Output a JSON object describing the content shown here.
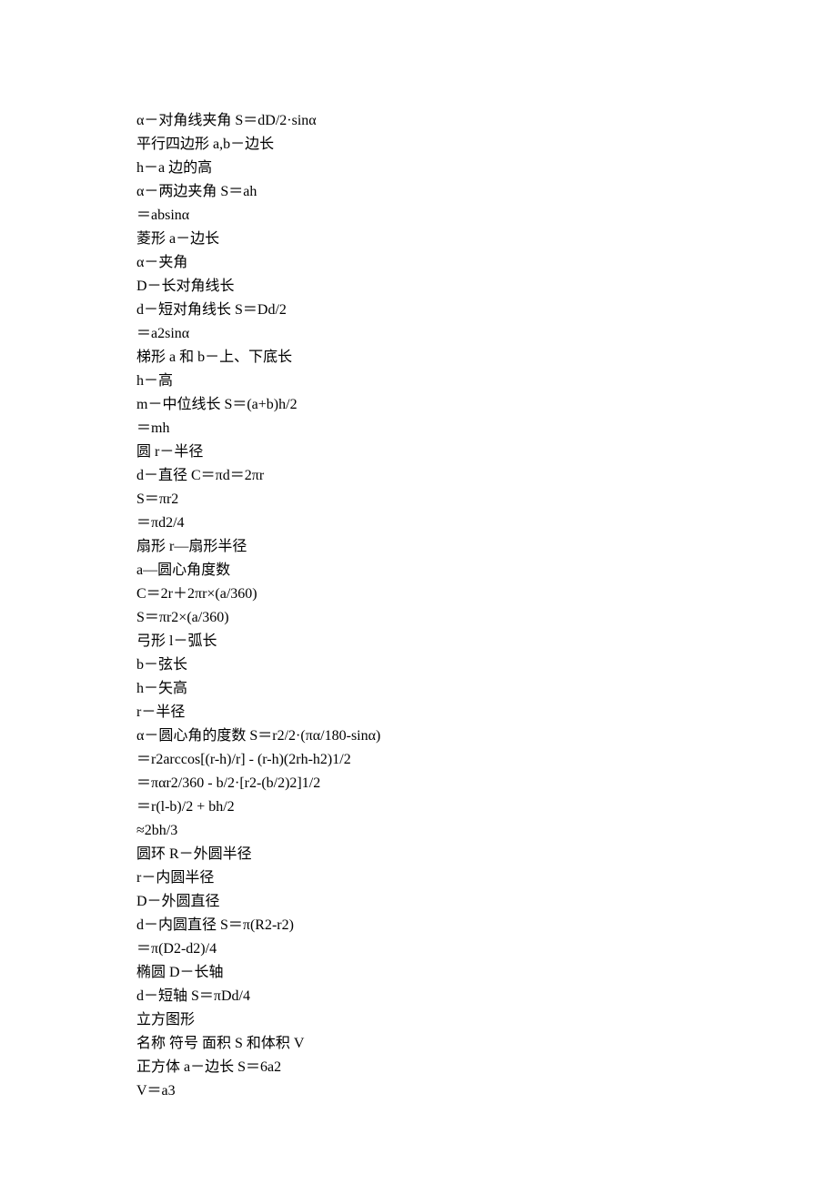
{
  "lines": [
    "α－对角线夹角 S＝dD/2·sinα",
    "平行四边形 a,b－边长",
    "h－a 边的高",
    "α－两边夹角 S＝ah",
    "＝absinα",
    "菱形 a－边长",
    "α－夹角",
    "D－长对角线长",
    "d－短对角线长 S＝Dd/2",
    "＝a2sinα",
    "梯形 a 和 b－上、下底长",
    "h－高",
    "m－中位线长 S＝(a+b)h/2",
    "＝mh",
    "圆 r－半径",
    "d－直径 C＝πd＝2πr",
    "S＝πr2",
    "＝πd2/4",
    "扇形 r—扇形半径",
    "a—圆心角度数",
    "C＝2r＋2πr×(a/360)",
    "S＝πr2×(a/360)",
    "弓形 l－弧长",
    "b－弦长",
    "h－矢高",
    "r－半径",
    "α－圆心角的度数 S＝r2/2·(πα/180-sinα)",
    "＝r2arccos[(r-h)/r] - (r-h)(2rh-h2)1/2",
    "＝παr2/360 - b/2·[r2-(b/2)2]1/2",
    "＝r(l-b)/2 + bh/2",
    "≈2bh/3",
    "圆环 R－外圆半径",
    "r－内圆半径",
    "D－外圆直径",
    "d－内圆直径 S＝π(R2-r2)",
    "＝π(D2-d2)/4",
    "椭圆 D－长轴",
    "d－短轴 S＝πDd/4",
    "立方图形",
    "名称 符号 面积 S 和体积 V",
    "正方体 a－边长 S＝6a2",
    "V＝a3"
  ]
}
